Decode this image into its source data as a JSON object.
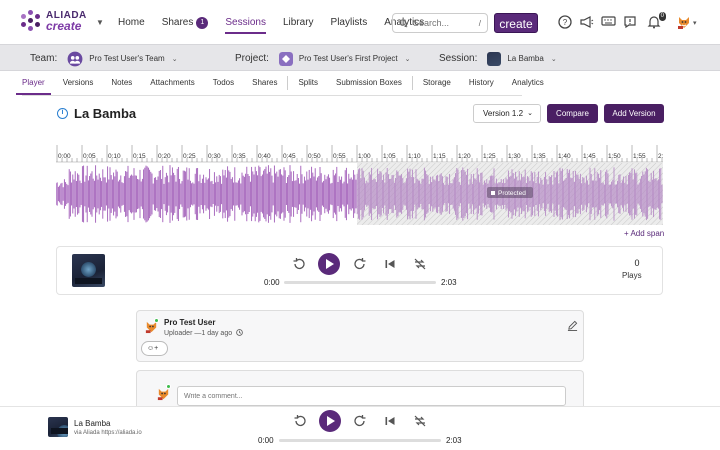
{
  "brand": {
    "line1": "ALIADA",
    "line2": "create"
  },
  "nav": {
    "items": [
      {
        "label": "Home"
      },
      {
        "label": "Shares",
        "badge": "1"
      },
      {
        "label": "Sessions",
        "active": true
      },
      {
        "label": "Library"
      },
      {
        "label": "Playlists"
      },
      {
        "label": "Analytics"
      }
    ],
    "search_placeholder": "Search...",
    "search_shortcut": "/",
    "create_label": "create",
    "notifications_count": "0",
    "icons": [
      "help-circle-icon",
      "megaphone-icon",
      "keyboard-icon",
      "feedback-icon",
      "bell-icon"
    ]
  },
  "context": {
    "team_label": "Team:",
    "team_value": "Pro Test User's Team",
    "project_label": "Project:",
    "project_value": "Pro Test User's First Project",
    "session_label": "Session:",
    "session_value": "La Bamba"
  },
  "tabs": [
    {
      "label": "Player",
      "active": true
    },
    {
      "label": "Versions"
    },
    {
      "label": "Notes"
    },
    {
      "label": "Attachments"
    },
    {
      "label": "Todos"
    },
    {
      "label": "Shares"
    },
    {
      "label": "Splits",
      "sep_before": true
    },
    {
      "label": "Submission Boxes"
    },
    {
      "label": "Storage",
      "sep_before": true
    },
    {
      "label": "History"
    },
    {
      "label": "Analytics"
    }
  ],
  "session": {
    "title": "La Bamba",
    "version_label": "Version 1.2",
    "compare_label": "Compare",
    "add_version_label": "Add Version"
  },
  "timeline": {
    "ticks": [
      "0:00",
      "0:05",
      "0:10",
      "0:15",
      "0:20",
      "0:25",
      "0:30",
      "0:35",
      "0:40",
      "0:45",
      "0:50",
      "0:55",
      "1:00",
      "1:05",
      "1:10",
      "1:15",
      "1:20",
      "1:25",
      "1:30",
      "1:35",
      "1:40",
      "1:45",
      "1:50",
      "1:55",
      "2:00"
    ],
    "protected_label": "Protected",
    "protected_from_seconds": 60,
    "duration_seconds": 123,
    "add_span_label": "+ Add span"
  },
  "player": {
    "current_time": "0:00",
    "duration": "2:03",
    "progress": 0,
    "plays_count": "0",
    "plays_label": "Plays"
  },
  "comment": {
    "user": "Pro Test User",
    "meta": "Uploader —1 day ago",
    "react_label": "☺+"
  },
  "new_comment": {
    "placeholder": "Write a comment..."
  },
  "bottom_player": {
    "title": "La Bamba",
    "subtitle": "via Aliada https://aliada.io",
    "current_time": "0:00",
    "duration": "2:03"
  },
  "colors": {
    "accent": "#5a2a7a",
    "wave": "#a05bb8",
    "wave_protected": "#b58ac5"
  }
}
